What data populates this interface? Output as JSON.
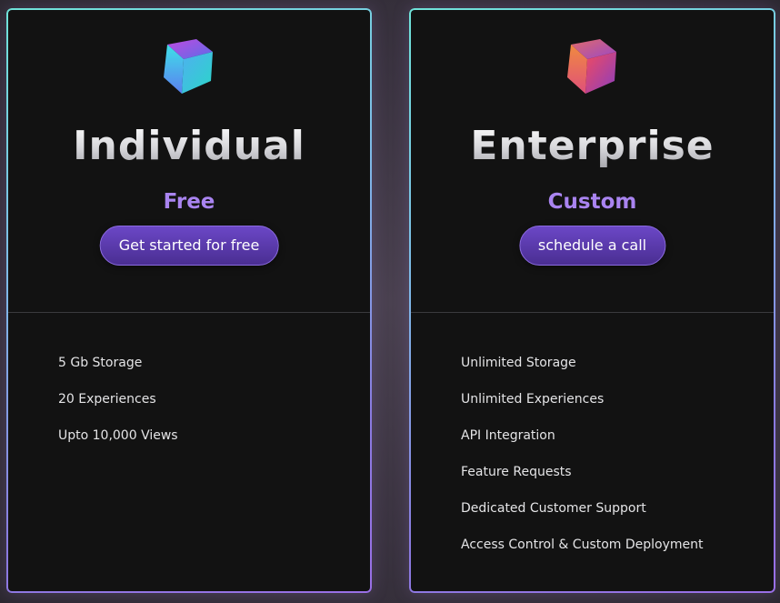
{
  "plans": [
    {
      "name": "Individual",
      "price": "Free",
      "cta_label": "Get started for free",
      "icon": "cube-icon",
      "icon_colors": [
        "#3fe0e8",
        "#4a7fe6",
        "#b040e0"
      ],
      "features": [
        "5 Gb Storage",
        "20 Experiences",
        "Upto 10,000 Views"
      ]
    },
    {
      "name": "Enterprise",
      "price": "Custom",
      "cta_label": "schedule a call",
      "icon": "cube-icon",
      "icon_colors": [
        "#f08040",
        "#e04070",
        "#9040c0"
      ],
      "features": [
        "Unlimited Storage",
        "Unlimited Experiences",
        "API Integration",
        "Feature Requests",
        "Dedicated Customer Support",
        "Access Control & Custom Deployment"
      ]
    }
  ],
  "colors": {
    "accent": "#a984f0",
    "button": "#5a3aae",
    "card_bg": "#121212"
  }
}
